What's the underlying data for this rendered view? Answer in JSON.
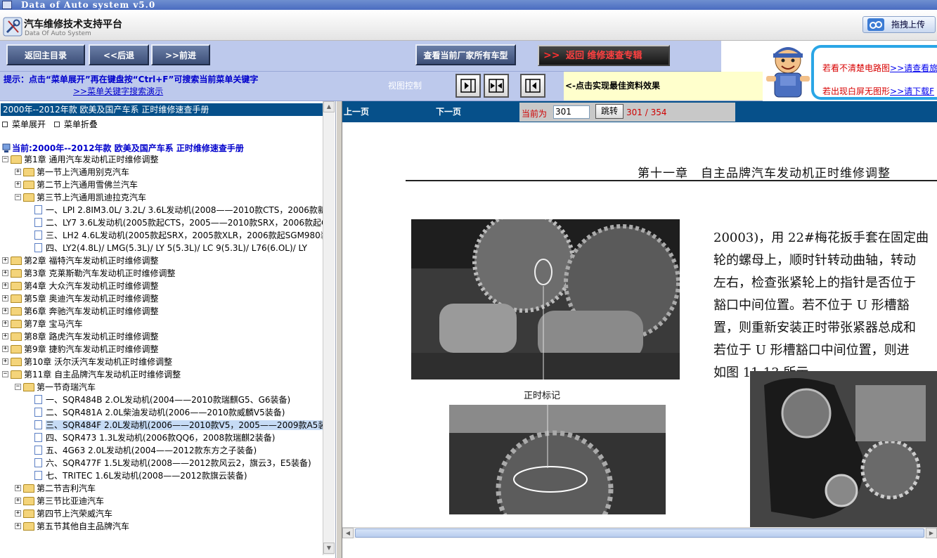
{
  "window": {
    "title": "Data of Auto system v5.0"
  },
  "header": {
    "app_title": "汽车维修技术支持平台",
    "app_subtitle": "Data Of Auto System",
    "upload_label": "拖拽上传"
  },
  "nav": {
    "home": "返回主目录",
    "back": "<<后退",
    "forward": ">>前进",
    "all_models": "查看当前厂家所有车型",
    "return_arrows": ">>",
    "return_label": "返回",
    "return_target": "维修速查专辑"
  },
  "hint": {
    "text": "提示：点击“菜单展开”再在键盘按“Ctrl+F”可搜索当前菜单关键字",
    "demo_link": ">>菜单关键字搜索演示",
    "view_control": "视图控制",
    "view_tip": "<-点击实现最佳资料效果"
  },
  "info": {
    "line1_text": "若看不清楚电路图",
    "line1_link": ">>请查看旅",
    "line2_text": "若出现白屏无图形",
    "line2_link": ">>请下载F"
  },
  "tree": {
    "header": "2000年--2012年款 欧美及国产车系 正时维修速查手册",
    "expand": "菜单展开",
    "collapse": "菜单折叠",
    "current": "当前:2000年--2012年款 欧美及国产车系 正时维修速查手册",
    "nodes": [
      {
        "label": "第1章 通用汽车发动机正时维修调整",
        "level": 0,
        "type": "folder",
        "pm": "-"
      },
      {
        "label": "第一节上汽通用别克汽车",
        "level": 1,
        "type": "folder",
        "pm": "+"
      },
      {
        "label": "第二节上汽通用雪佛兰汽车",
        "level": 1,
        "type": "folder",
        "pm": "+"
      },
      {
        "label": "第三节上汽通用凯迪拉克汽车",
        "level": 1,
        "type": "folder",
        "pm": "-"
      },
      {
        "label": "一、LPI 2.8IM3.0L/ 3.2L/ 3.6L发动机(2008——2010款CTS，2006款新",
        "level": 2,
        "type": "doc"
      },
      {
        "label": "二、LY7 3.6L发动机(2005款起CTS，2005——2010款SRX，2006款起C",
        "level": 2,
        "type": "doc"
      },
      {
        "label": "三、LH2 4.6L发动机(2005款起SRX，2005款XLR，2006款起SGM980装",
        "level": 2,
        "type": "doc"
      },
      {
        "label": "四、LY2(4.8L)/ LMG(5.3L)/ LY 5(5.3L)/ LC 9(5.3L)/ L76(6.OL)/ LY",
        "level": 2,
        "type": "doc"
      },
      {
        "label": "第2章 福特汽车发动机正时维修调整",
        "level": 0,
        "type": "folder",
        "pm": "+"
      },
      {
        "label": "第3章 克莱斯勒汽车发动机正时维修调整",
        "level": 0,
        "type": "folder",
        "pm": "+"
      },
      {
        "label": "第4章 大众汽车发动机正时维修调整",
        "level": 0,
        "type": "folder",
        "pm": "+"
      },
      {
        "label": "第5章 奥迪汽车发动机正时维修调整",
        "level": 0,
        "type": "folder",
        "pm": "+"
      },
      {
        "label": "第6章 奔驰汽车发动机正时维修调整",
        "level": 0,
        "type": "folder",
        "pm": "+"
      },
      {
        "label": "第7章 宝马汽车",
        "level": 0,
        "type": "folder",
        "pm": "+"
      },
      {
        "label": "第8章 路虎汽车发动机正时维修调整",
        "level": 0,
        "type": "folder",
        "pm": "+"
      },
      {
        "label": "第9章 捷豹汽车发动机正时维修调整",
        "level": 0,
        "type": "folder",
        "pm": "+"
      },
      {
        "label": "第10章 沃尔沃汽车发动机正时维修调整",
        "level": 0,
        "type": "folder",
        "pm": "+"
      },
      {
        "label": "第11章 自主品牌汽车发动机正时维修调整",
        "level": 0,
        "type": "folder",
        "pm": "-"
      },
      {
        "label": "第一节奇瑞汽车",
        "level": 1,
        "type": "folder",
        "pm": "-"
      },
      {
        "label": "一、SQR484B 2.OL发动机(2004——2010款瑞麒G5、G6装备)",
        "level": 2,
        "type": "doc"
      },
      {
        "label": "二、SQR481A 2.0L柴油发动机(2006——2010款威麟V5装备)",
        "level": 2,
        "type": "doc"
      },
      {
        "label": "三、SQR484F 2.0L发动机(2006——2010款V5，2005——2009款A5装备",
        "level": 2,
        "type": "doc",
        "selected": true
      },
      {
        "label": "四、SQR473 1.3L发动机(2006款QQ6，2008款瑞麒2装备)",
        "level": 2,
        "type": "doc"
      },
      {
        "label": "五、4G63 2.0L发动机(2004——2012款东方之子装备)",
        "level": 2,
        "type": "doc"
      },
      {
        "label": "六、SQR477F 1.5L发动机(2008——2012款风云2，旗云3，E5装备)",
        "level": 2,
        "type": "doc"
      },
      {
        "label": "七、TRITEC 1.6L发动机(2008——2012款旗云装备)",
        "level": 2,
        "type": "doc"
      },
      {
        "label": "第二节吉利汽车",
        "level": 1,
        "type": "folder",
        "pm": "+"
      },
      {
        "label": "第三节比亚迪汽车",
        "level": 1,
        "type": "folder",
        "pm": "+"
      },
      {
        "label": "第四节上汽荣威汽车",
        "level": 1,
        "type": "folder",
        "pm": "+"
      },
      {
        "label": "第五节其他自主品牌汽车",
        "level": 1,
        "type": "folder",
        "pm": "+"
      }
    ]
  },
  "pager": {
    "prev": "上一页",
    "next": "下一页",
    "current_label": "当前为",
    "page_value": "301",
    "go": "跳转",
    "count": "301 / 354"
  },
  "document": {
    "chapter_title": "第十一章　自主品牌汽车发动机正时维修调整",
    "body_lines": [
      "20003)，用 22#梅花扳手套在固定曲",
      "轮的螺母上，顺时针转动曲轴，转动",
      "左右，检查张紧轮上的指针是否位于",
      "豁口中间位置。若不位于 U 形槽豁",
      "置，则重新安装正时带张紧器总成和",
      "若位于 U 形槽豁口中间位置，则进",
      "如图 11-13 所示。"
    ],
    "photo_caption": "正时标记"
  },
  "colors": {
    "nav_blue": "#bdc9ec",
    "header_navy": "#06508a",
    "link_blue": "#0000cc",
    "accent_red": "#d00000"
  }
}
